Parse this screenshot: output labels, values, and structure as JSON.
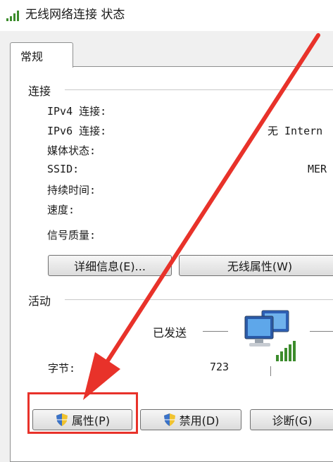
{
  "window": {
    "title": "无线网络连接 状态",
    "title_icon": "wifi-signal-icon"
  },
  "tabs": [
    {
      "label": "常规",
      "active": true
    }
  ],
  "connection": {
    "group_title": "连接",
    "rows": [
      {
        "label": "IPv4 连接:",
        "value": ""
      },
      {
        "label": "IPv6 连接:",
        "value": "无 Intern"
      },
      {
        "label": "媒体状态:",
        "value": ""
      },
      {
        "label": "SSID:",
        "value": "MER"
      },
      {
        "label": "持续时间:",
        "value": ""
      },
      {
        "label": "速度:",
        "value": ""
      },
      {
        "label": "信号质量:",
        "value": ""
      }
    ],
    "details_button": "详细信息(E)...",
    "wireless_props_button": "无线属性(W)"
  },
  "activity": {
    "group_title": "活动",
    "sent_label": "已发送",
    "bytes_label": "字节:",
    "bytes_sent": "723",
    "network_icon": "network-computers-icon"
  },
  "buttons": {
    "properties": "属性(P)",
    "disable": "禁用(D)",
    "diagnose": "诊断(G)"
  },
  "annotation": {
    "color": "#e8322a",
    "arrow_icon": "red-arrow-icon"
  }
}
